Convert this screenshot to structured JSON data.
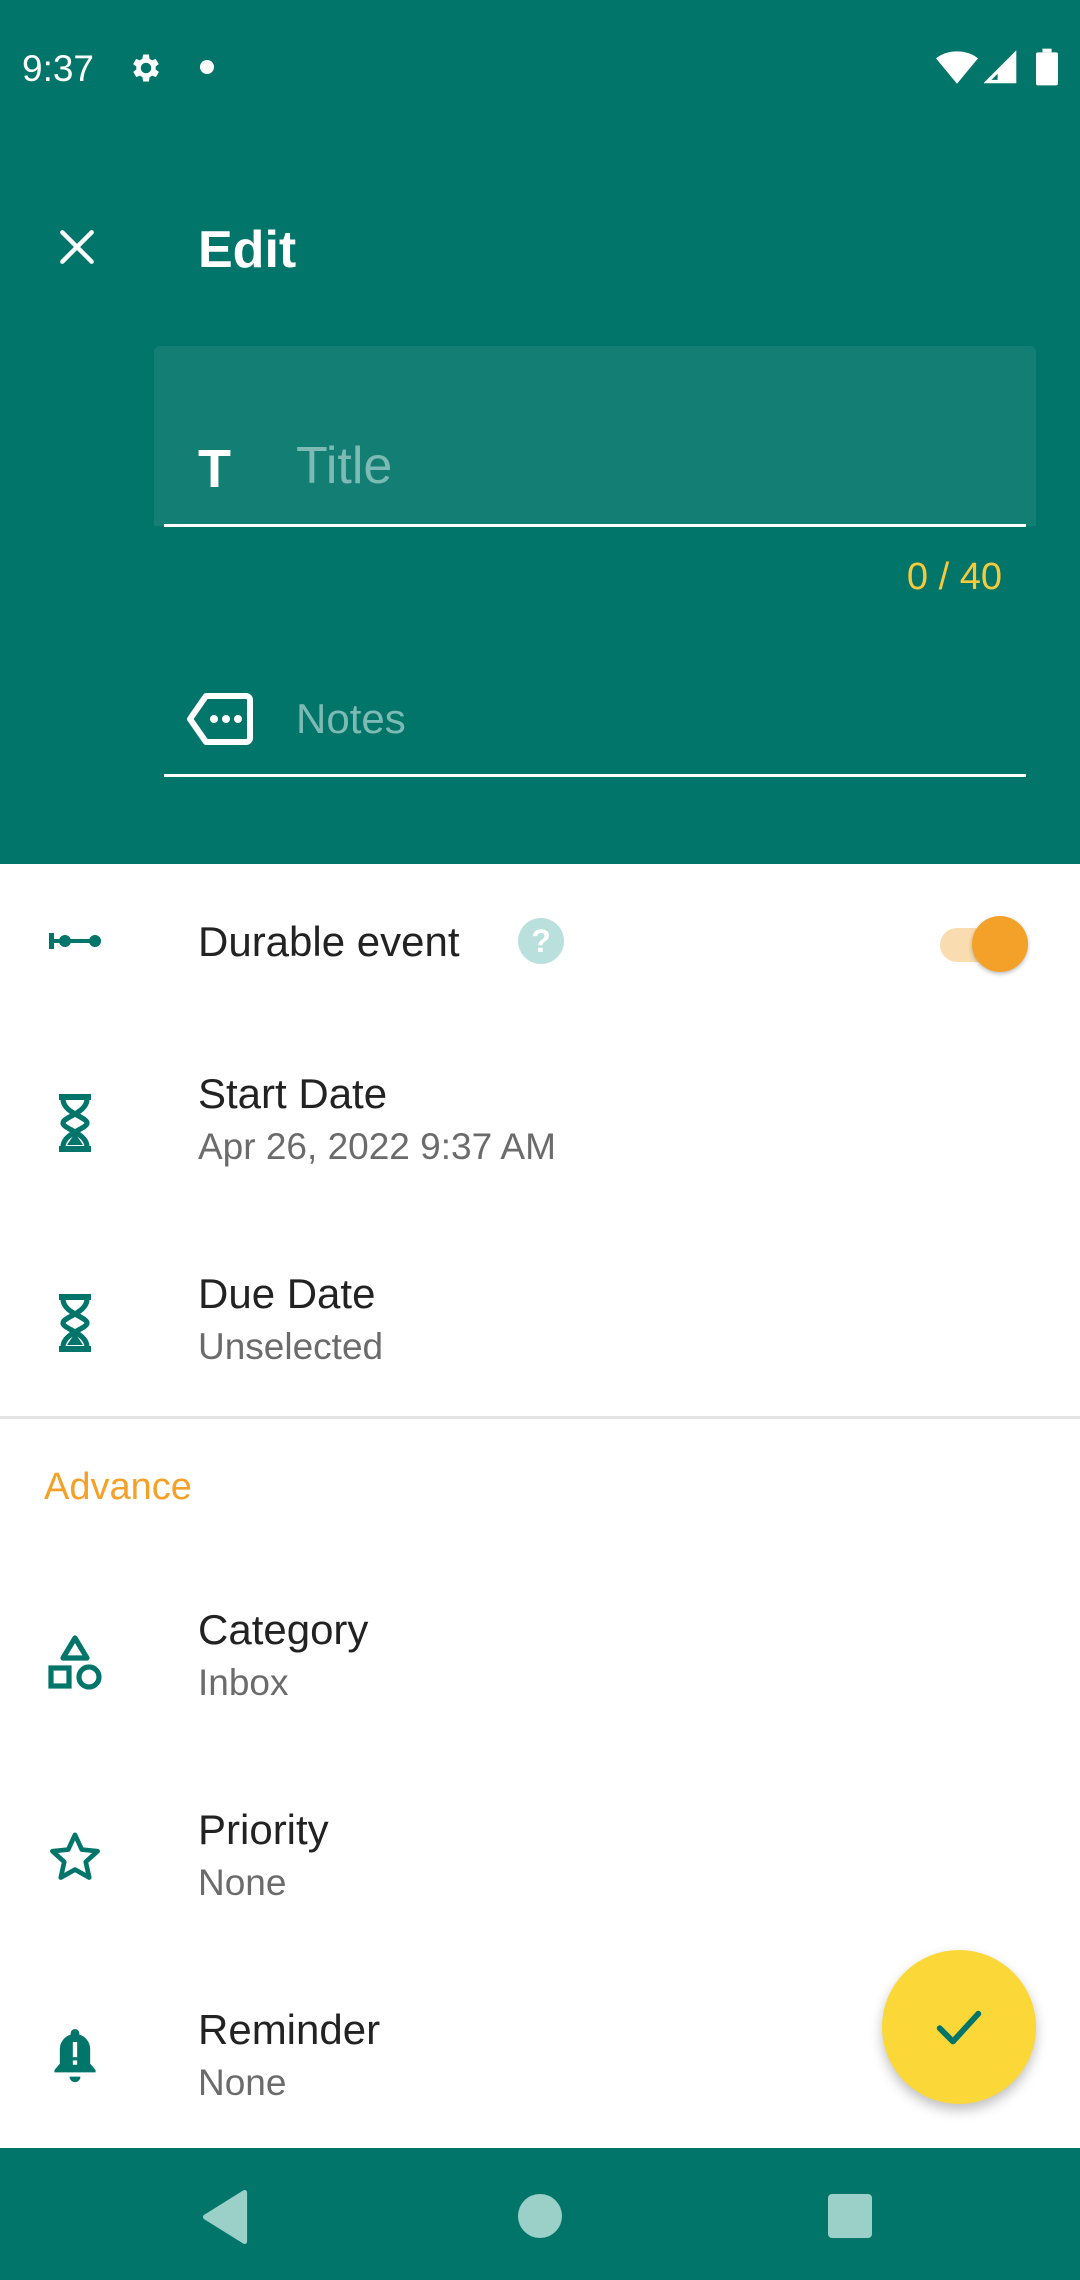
{
  "status_bar": {
    "time": "9:37",
    "icons": [
      "gear-icon",
      "notification-dot",
      "wifi-icon",
      "signal-icon",
      "battery-icon"
    ]
  },
  "header": {
    "title": "Edit",
    "close_icon": "close-icon"
  },
  "title_field": {
    "icon": "T",
    "placeholder": "Title",
    "value": "",
    "char_count": "0 / 40"
  },
  "notes_field": {
    "icon": "notes-tag-icon",
    "placeholder": "Notes",
    "value": ""
  },
  "durable_event": {
    "label": "Durable event",
    "help": "?",
    "enabled": true
  },
  "start_date": {
    "label": "Start Date",
    "value": "Apr 26, 2022 9:37 AM"
  },
  "due_date": {
    "label": "Due Date",
    "value": "Unselected"
  },
  "advance": {
    "section_label": "Advance",
    "category": {
      "label": "Category",
      "value": "Inbox"
    },
    "priority": {
      "label": "Priority",
      "value": "None"
    },
    "reminder": {
      "label": "Reminder",
      "value": "None"
    }
  },
  "fab": {
    "icon": "check-icon"
  },
  "nav_bar": {
    "icons": [
      "back-icon",
      "home-icon",
      "recents-icon"
    ]
  },
  "colors": {
    "primary": "#02756a",
    "accent": "#f4a12a",
    "fab": "#fbd738",
    "counter": "#f9c93a"
  }
}
